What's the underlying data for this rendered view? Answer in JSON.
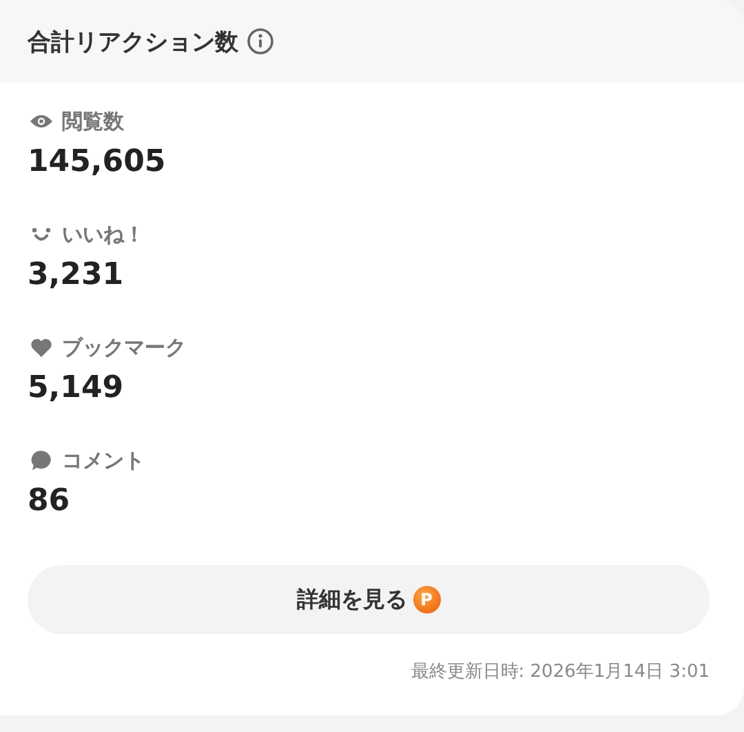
{
  "header": {
    "title": "合計リアクション数"
  },
  "metrics": [
    {
      "kind": "views",
      "label": "閲覧数",
      "value": "145,605"
    },
    {
      "kind": "likes",
      "label": "いいね！",
      "value": "3,231"
    },
    {
      "kind": "bookmarks",
      "label": "ブックマーク",
      "value": "5,149"
    },
    {
      "kind": "comments",
      "label": "コメント",
      "value": "86"
    }
  ],
  "button": {
    "label": "詳細を見る",
    "badge": "P"
  },
  "footer": "最終更新日時: 2026年1月14日 3:01"
}
